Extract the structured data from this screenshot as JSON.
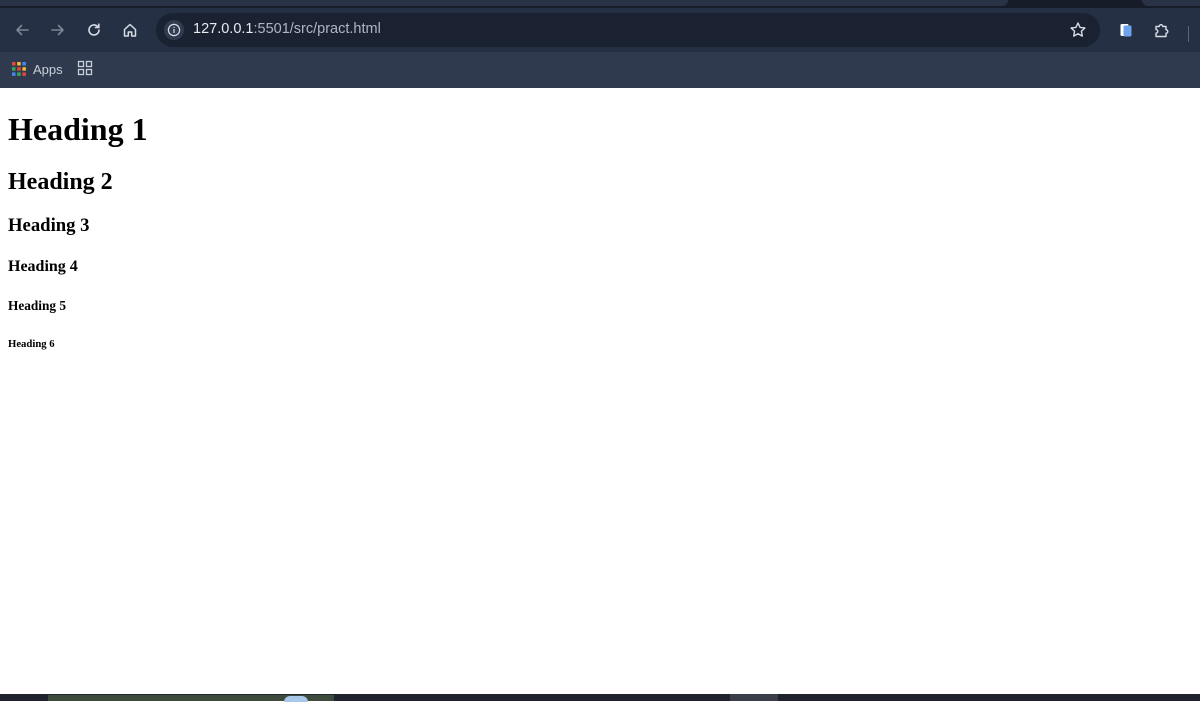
{
  "browser": {
    "address_bar": {
      "host": "127.0.0.1",
      "path": ":5501/src/pract.html"
    },
    "bookmarks": {
      "apps_label": "Apps"
    },
    "icons": {
      "back": "arrow-left-icon",
      "forward": "arrow-right-icon",
      "reload": "reload-icon",
      "home": "home-icon",
      "site_info": "info-icon",
      "bookmark": "star-icon",
      "extension_1": "clipboard-icon",
      "extensions": "puzzle-icon",
      "apps": "apps-grid-icon",
      "tab_groups": "tab-groups-icon"
    },
    "colors": {
      "chrome_bg": "#263044",
      "bookmarks_bg": "#2f3a4e",
      "omnibox_bg": "#1a2130"
    }
  },
  "page": {
    "h1": "Heading 1",
    "h2": "Heading 2",
    "h3": "Heading 3",
    "h4": "Heading 4",
    "h5": "Heading 5",
    "h6": "Heading 6"
  }
}
